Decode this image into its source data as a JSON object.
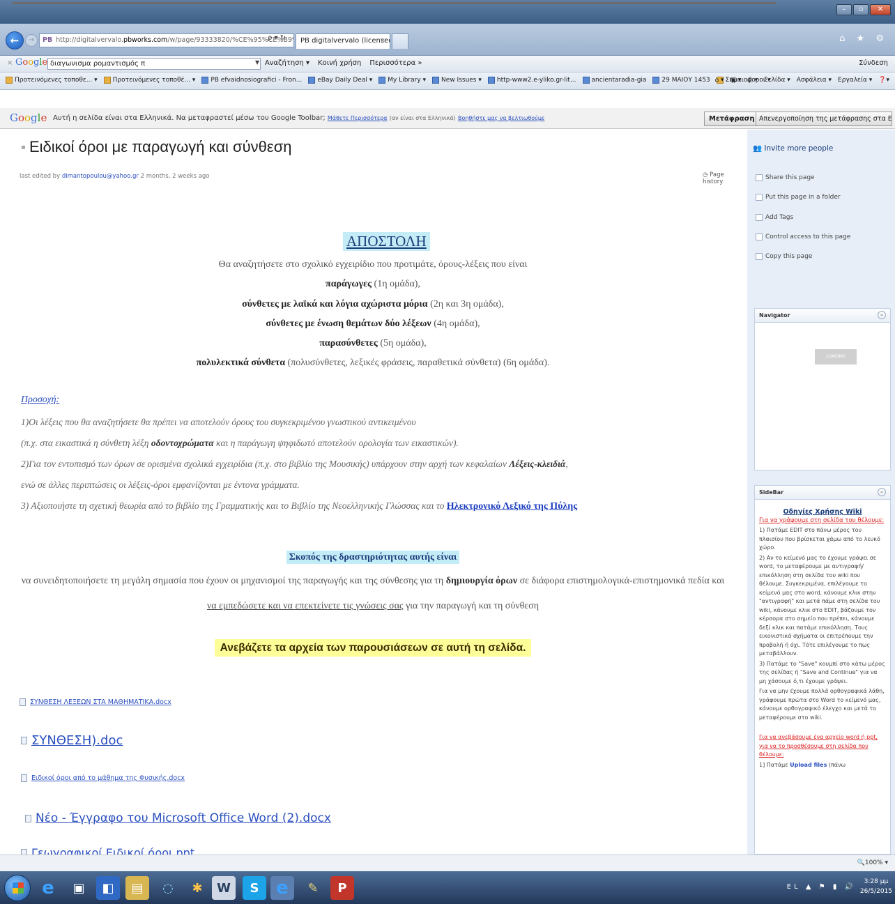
{
  "browser": {
    "address_prefix": "PB",
    "address_pre": "http://digitalvervalo.",
    "address_domain": "pbworks.com",
    "address_rest": "/w/page/93333820/%CE%95%CE%B9%CE%B4%CE%B9%CE%BA",
    "address_tools": "ρ ▾ ↻",
    "tab_title": "PB digitalvervalo (licensed f...",
    "tab_close": "×",
    "nav_right_icons": "⌂ ★ ⚙"
  },
  "google_toolbar": {
    "close": "×",
    "search_value": "διαγωνισμα ρομαντισμός π",
    "items": [
      "Αναζήτηση ▾",
      "Κοινή χρήση",
      "Περισσότερα »"
    ],
    "signin": "Σύνδεση"
  },
  "bookmarks": [
    "Προτεινόμενες τοποθε... ▾",
    "Προτεινόμενες τοποθέ... ▾",
    "PB efvaidnosiografici - Fron...",
    "eBay Daily Deal ▾",
    "My Library ▾",
    "New Issues ▾",
    "http-www2.e-yliko.gr-lit...",
    "ancientaradia-gia",
    "29 ΜΑΙΟΥ 1453",
    "Σημαιοφοροι ▾"
  ],
  "command_bar": [
    "Σελίδα ▾",
    "Ασφάλεια ▾",
    "Εργαλεία ▾"
  ],
  "translate_bar": {
    "logo": "Google",
    "message": "Αυτή η σελίδα είναι στα Ελληνικά. Να μεταφραστεί μέσω του Google Toolbar;",
    "link_more": "Μάθετε Περισσότερα",
    "link_note": "(αν είναι στα Ελληνικά)",
    "link_bad": "Βοηθήστε μας να βελτιωθούμε",
    "translate_button": "Μετάφραση",
    "disable_button": "Απενεργοποίηση της μετάφρασης στα Ελληνικά"
  },
  "page": {
    "title": "Ειδικοί όροι με παραγωγή και σύνθεση",
    "edited_prefix": "last edited by",
    "edited_user": "dimantopoulou@yahoo.gr",
    "edited_time": "2 months, 2 weeks ago",
    "page_history": "Page history",
    "mission_heading": "ΑΠΟΣΤΟΛΗ",
    "mission_intro": "Θα αναζητήσετε στο σχολικό εγχειρίδιο που προτιμάτε, όρους-λέξεις που είναι",
    "mission_items": [
      {
        "bold": "παράγωγες",
        "rest": " (1η ομάδα),"
      },
      {
        "bold": "σύνθετες με λαϊκά και λόγια αχώριστα μόρια",
        "rest": " (2η και 3η ομάδα),"
      },
      {
        "bold": "σύνθετες με ένωση θεμάτων δύο λέξεων",
        "rest": " (4η ομάδα),"
      },
      {
        "bold": "παρασύνθετες",
        "rest": " (5η ομάδα),"
      },
      {
        "bold": "πολυλεκτικά σύνθετα",
        "rest": " (πολυσύνθετες, λεξικές φράσεις, παραθετικά σύνθετα) (6η ομάδα)."
      }
    ],
    "note_label": "Προσοχή:",
    "note_lines": [
      {
        "pre": "1)Οι λέξεις που θα αναζητήσετε θα πρέπει να αποτελούν όρους του συγκεκριμένου γνωστικού αντικειμένου",
        "bold": "",
        "post": ""
      },
      {
        "pre": "(π.χ. στα εικαστικά η σύνθετη λέξη ",
        "bold": "οδοντοχρώματα",
        "post": " και η παράγωγη ψηφιδωτό αποτελούν ορολογία των εικαστικών)."
      },
      {
        "pre": "2)Για τον εντοπισμό των όρων σε ορισμένα σχολικά εγχειρίδια (π.χ. στο βιβλίο της Μουσικής) υπάρχουν στην αρχή των κεφαλαίων ",
        "bold": "Λέξεις-κλειδιά",
        "post": ","
      },
      {
        "pre": "ενώ σε άλλες περιπτώσεις οι λέξεις-όροι εμφανίζονται με έντονα γράμματα.",
        "bold": "",
        "post": ""
      },
      {
        "pre": "3) Αξιοποιήστε τη σχετική θεωρία από το βιβλίο της Γραμματικής και το Βιβλίο της Νεοελληνικής Γλώσσας και το ",
        "bold": "",
        "post": ""
      }
    ],
    "dict_link": "Ηλεκτρονικό Λεξικό της Πύλης",
    "purpose_heading": "Σκοπός της δραστηριότητας αυτής είναι",
    "purpose_line1_pre": "να συνειδητοποιήσετε τη μεγάλη σημασία που έχουν οι μηχανισμοί της παραγωγής και της σύνθεσης για τη ",
    "purpose_line1_bold": "δημιουργία όρων",
    "purpose_line1_post": " σε διάφορα επιστημολογικά-επιστημονικά πεδία και",
    "purpose_line2_u": "να εμπεδώσετε και να επεκτείνετε τις γνώσεις σας",
    "purpose_line2_rest": " για την παραγωγή και τη σύνθεση",
    "upload_note": "Ανεβάζετε τα αρχεία των παρουσιάσεων σε αυτή τη σελίδα.",
    "files": [
      "ΣΥΝΘΕΣΗ ΛΕΞΕΩΝ ΣΤΑ ΜΑΘΗΜΑΤΙΚΑ.docx",
      "ΣΥΝΘΕΣΗ).doc",
      "Ειδικοί όροι από το μάθημα της Φυσικής.docx",
      "Νέο - Έγγραφο του Microsoft Office Word (2).docx",
      "Γεωγραφικοί Ειδικοί όροι.ppt"
    ]
  },
  "sidebar": {
    "invite": "Invite more people",
    "actions": [
      "Share this page",
      "Put this page in a folder",
      "Add Tags",
      "Control access to this page",
      "Copy this page"
    ],
    "navigator_title": "Navigator",
    "loading": "LOADING",
    "sidebar_title": "SideBar",
    "sp_title": "Οδηγίες Χρήσης Wiki",
    "sp_sub": "Για να γράψουμε στη σελίδα του θέλουμε:",
    "sp_lines": [
      "1) Πατάμε EDIT στο πάνω μέρος του πλαισίου που βρίσκεται χάμω από το λευκό χώρο.",
      "2) Αν το κείμενό μας το έχουμε γράψει σε word, το μεταφέρουμε με αντιγραφή/επικόλληση στη σελίδα του wiki που θέλουμε. Συγκεκριμένα, επιλέγουμε το κείμενό μας στο word, κάνουμε κλικ στην \"αντιγραφή\" και μετά πάμε στη σελίδα του wiki, κάνουμε κλικ στο EDIT, βάζουμε τον κέρσορα στο σημείο που πρέπει, κάνουμε δεξί κλικ και πατάμε επικόλληση. Τους εικονιστικά σχήματα οι επιτρέπουμε την προβολή ή όχι. Τότε επιλέγουμε το πως μεταβάλλουν.",
      "3) Πατάμε το \"Save\" κουμπί στο κάτω μέρος της σελίδας ή \"Save and Continue\" για να μη χάσουμε ό,τι έχουμε γράψει.",
      "Για να μην έχουμε πολλά ορθογραφικά λάθη, γράφουμε πρώτα στο Word το κείμενό μας, κάνουμε ορθογραφικό έλεγχο και μετά το μεταφέρουμε στο wiki."
    ],
    "sp_red2": "Για να ανεβάσουμε ένα αρχείο word ή ppt, για να το προσθέσουμε στη σελίδα που θέλουμε:",
    "sp_last_pre": "1] Πατάμε ",
    "sp_last_bold": "Upload files",
    "sp_last_post": " (πάνω"
  },
  "status": {
    "zoom": "🔍100% ▾"
  },
  "taskbar": {
    "tray": "EL ▲ ⚑ ▮ 🔊",
    "time": "3:28 μμ",
    "date": "26/5/2015"
  },
  "colors": {
    "accent_link": "#2a4fbf",
    "heading_highlight": "#c4ecf7",
    "upload_highlight": "#ffff99",
    "sidebar_bg": "#e7eef7"
  }
}
